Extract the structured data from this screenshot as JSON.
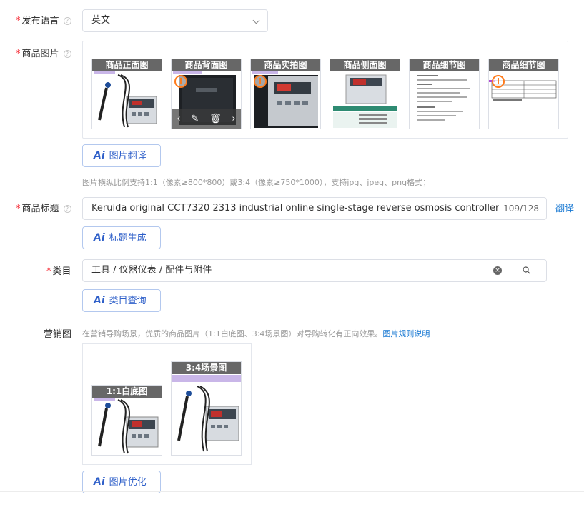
{
  "language": {
    "label": "发布语言",
    "value": "英文"
  },
  "images": {
    "label": "商品图片",
    "items": [
      {
        "caption": "商品正面图",
        "warning": false
      },
      {
        "caption": "商品背面图",
        "warning": true,
        "hovered": true
      },
      {
        "caption": "商品实拍图",
        "warning": true
      },
      {
        "caption": "商品侧面图",
        "warning": false
      },
      {
        "caption": "商品细节图",
        "warning": false
      },
      {
        "caption": "商品细节图",
        "warning": true
      }
    ],
    "translate_button": "图片翻译",
    "hint": "图片横纵比例支持1:1（像素≥800*800）或3:4（像素≥750*1000），支持jpg、jpeg、png格式；"
  },
  "title": {
    "label": "商品标题",
    "value": "Keruida original CCT7320 2313 industrial online single-stage reverse osmosis controller ROC",
    "count": "109/128",
    "translate_link": "翻译",
    "generate_button": "标题生成"
  },
  "category": {
    "label": "类目",
    "value": "工具 / 仪器仪表 / 配件与附件",
    "query_button": "类目查询"
  },
  "marketing": {
    "label": "营销图",
    "hint": "在营销导购场景，优质的商品图片（1:1白底图、3:4场景图）对导购转化有正向效果。",
    "rules_link": "图片规则说明",
    "items": [
      {
        "caption": "1:1白底图"
      },
      {
        "caption": "3:4场景图"
      }
    ],
    "optimize_button": "图片优化"
  },
  "ai_label": "Ai",
  "colors": {
    "required": "#f5222d",
    "link": "#1677d2",
    "warning": "#ff7a1a",
    "ai_button": "#2e5fc9"
  }
}
